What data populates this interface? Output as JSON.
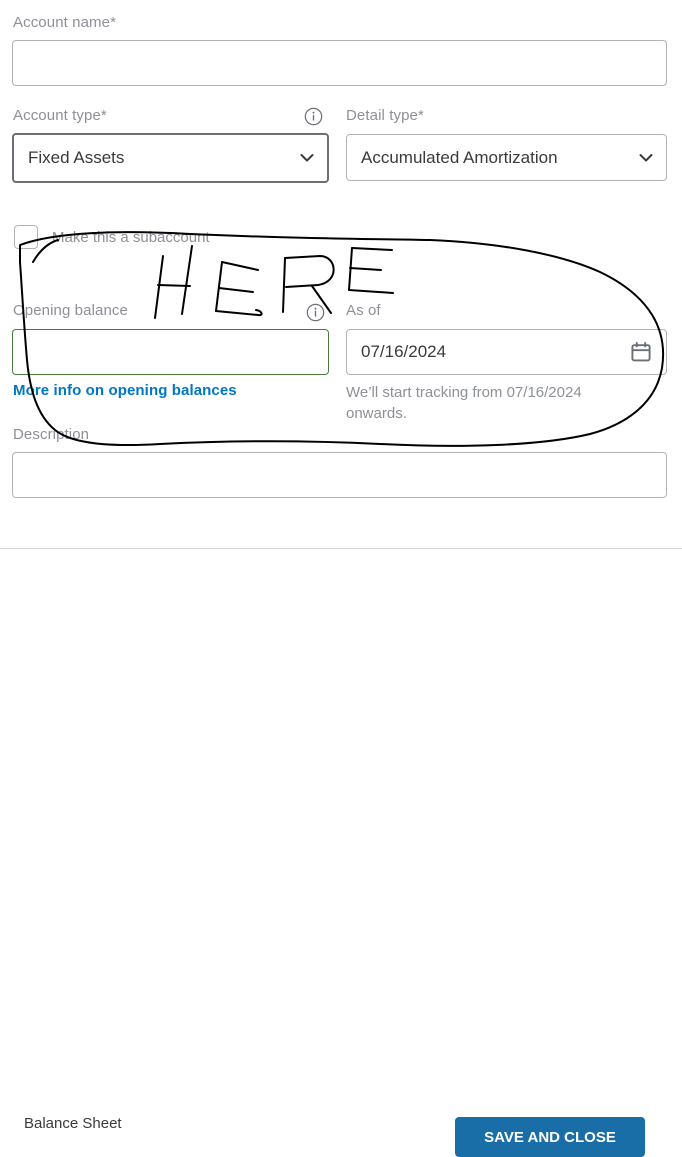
{
  "form": {
    "account_name": {
      "label": "Account name*",
      "value": "",
      "placeholder": ""
    },
    "account_type": {
      "label": "Account type*",
      "value": "Fixed Assets",
      "info_icon": "info-circle-icon",
      "chevron_icon": "chevron-down-icon"
    },
    "detail_type": {
      "label": "Detail type*",
      "value": "Accumulated Amortization",
      "chevron_icon": "chevron-down-icon"
    },
    "subaccount": {
      "label": "Make this a subaccount",
      "checked": false,
      "checkbox_icon": "checkbox-unchecked-icon"
    },
    "opening_balance": {
      "label": "Opening balance",
      "value": "",
      "placeholder": "",
      "info_icon": "info-circle-icon",
      "focus_border_color": "#4f7a3f",
      "link_text": "More info on opening balances",
      "link_color": "#0077c5"
    },
    "as_of": {
      "label": "As of",
      "value": "07/16/2024",
      "calendar_icon": "calendar-icon",
      "help_text": "We’ll start tracking from 07/16/2024 onwards."
    },
    "description": {
      "label": "Description",
      "value": "",
      "placeholder": ""
    }
  },
  "footer": {
    "left_text": "Balance Sheet",
    "primary_button_label": "SAVE AND CLOSE",
    "primary_button_color": "#1a6ea8"
  },
  "annotation": {
    "text": "HERE",
    "ink_color": "#000000",
    "shapes": [
      "ellipse-highlight",
      "handwritten-here-text"
    ]
  }
}
